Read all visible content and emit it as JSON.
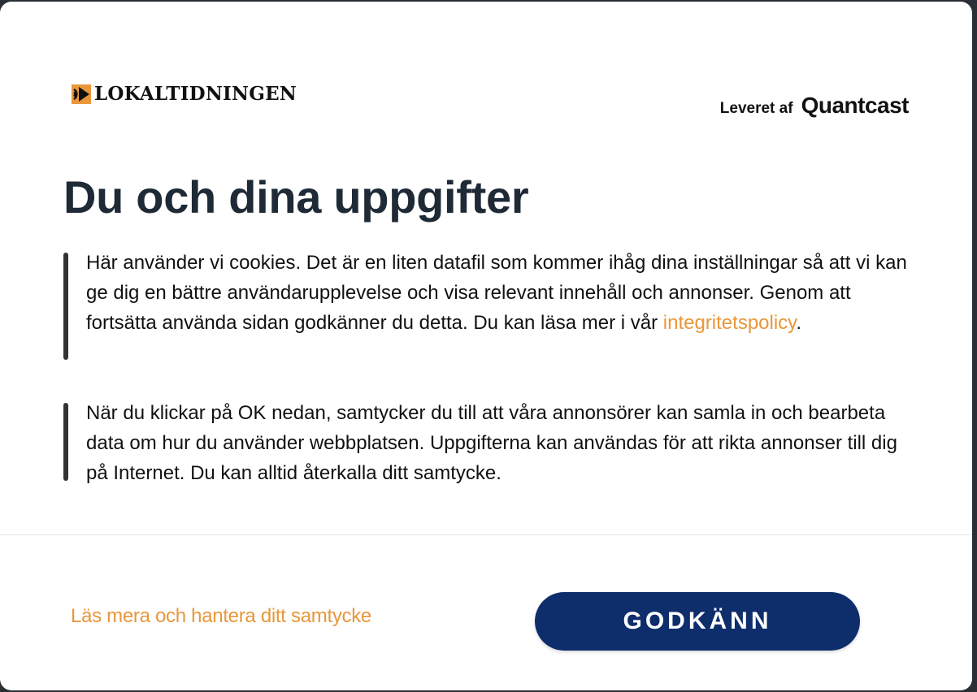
{
  "header": {
    "logo_text": "LOKALTIDNINGEN",
    "provider_label": "Leveret af",
    "provider_brand": "Quantcast"
  },
  "title": "Du och dina uppgifter",
  "paragraphs": {
    "p1_before": "Här använder vi cookies. Det är en liten datafil som kommer ihåg dina inställningar så att vi kan ge dig en bättre användarupplevelse och visa relevant innehåll och annonser. Genom att fortsätta använda sidan godkänner du detta. Du kan läsa mer i vår ",
    "p1_link": "integritetspolicy",
    "p1_after": ".",
    "p2": "När du klickar på OK nedan, samtycker du till att våra annonsörer kan samla in och bearbeta data om hur du använder webbplatsen. Uppgifterna kan användas för att rikta annonser till dig på Internet. Du kan alltid återkalla ditt samtycke."
  },
  "footer": {
    "manage_link": "Läs mera och hantera ditt samtycke",
    "accept_button": "GODKÄNN"
  },
  "colors": {
    "accent_link": "#e8973a",
    "button_bg": "#0e2d6b",
    "title_text": "#1f2a37",
    "logo_mark": "#e8973a"
  },
  "icons": {
    "logo_mark": "signal-waves-icon"
  }
}
